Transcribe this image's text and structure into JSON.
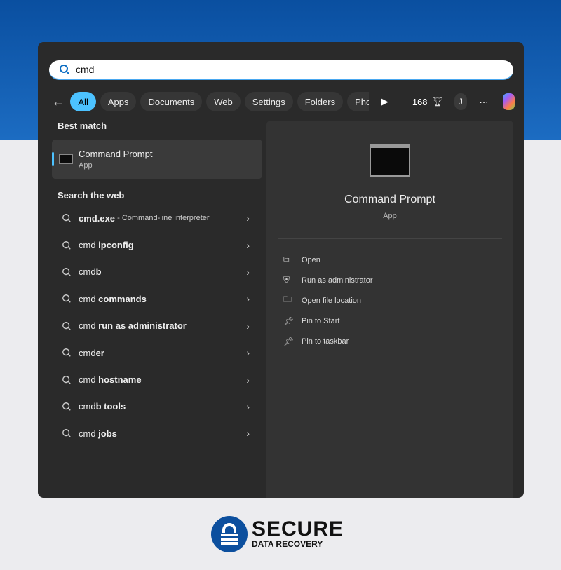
{
  "search": {
    "value": "cmd"
  },
  "filters": {
    "items": [
      "All",
      "Apps",
      "Documents",
      "Web",
      "Settings",
      "Folders",
      "Pho"
    ],
    "points": "168",
    "avatar": "J",
    "more": "···"
  },
  "left": {
    "best_match_header": "Best match",
    "best": {
      "title": "Command Prompt",
      "subtitle": "App"
    },
    "web_header": "Search the web",
    "web": [
      {
        "prefix": "cmd.exe",
        "suffix": "",
        "sub": " - Command-line interpreter"
      },
      {
        "prefix": "cmd ",
        "suffix": "ipconfig",
        "sub": ""
      },
      {
        "prefix": "cmd",
        "suffix": "b",
        "sub": ""
      },
      {
        "prefix": "cmd ",
        "suffix": "commands",
        "sub": ""
      },
      {
        "prefix": "cmd ",
        "suffix": "run as administrator",
        "sub": ""
      },
      {
        "prefix": "cmd",
        "suffix": "er",
        "sub": ""
      },
      {
        "prefix": "cmd ",
        "suffix": "hostname",
        "sub": ""
      },
      {
        "prefix": "cmd",
        "suffix": "b tools",
        "sub": ""
      },
      {
        "prefix": "cmd ",
        "suffix": "jobs",
        "sub": ""
      }
    ]
  },
  "right": {
    "title": "Command Prompt",
    "subtitle": "App",
    "actions": [
      {
        "icon": "open-icon",
        "label": "Open"
      },
      {
        "icon": "shield-icon",
        "label": "Run as administrator"
      },
      {
        "icon": "folder-icon",
        "label": "Open file location"
      },
      {
        "icon": "pin-icon",
        "label": "Pin to Start"
      },
      {
        "icon": "pin-icon",
        "label": "Pin to taskbar"
      }
    ]
  },
  "logo": {
    "line1": "SECURE",
    "line2": "DATA RECOVERY"
  },
  "colors": {
    "accent": "#4cc2ff",
    "brand": "#0c4f9e"
  }
}
